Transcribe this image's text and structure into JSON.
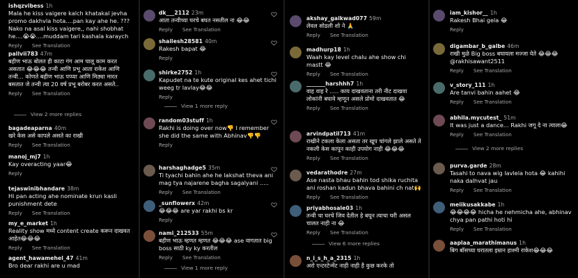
{
  "labels": {
    "reply": "Reply",
    "see_translation": "See Translation"
  },
  "col1": [
    {
      "user": "ishqzvibess",
      "time": "1h",
      "text": "Mala he kiss vaigere kalch khatakal jevha promo dakhvla hota....pan kay ahe he. ???\nNako na asal kiss vaigere,, nahi shobhat he....😭😭....muddam tari kashala karaych",
      "acts": true,
      "trans": true
    },
    {
      "user": "pallvii783",
      "time": "47m",
      "text": "बहीण भाऊ बोलत ही काटा गंग आम चालू काम करत असतात 😂😂😂 तन्वी आणि प्रभू आता राकेश आणि तन्वी... कोणते बहीण भाऊ पप्प्या आणि मिठ्या मारत बसतात जे तन्वी त्या 20 वर्ष प्रभू बरोबर करत असते..",
      "acts": true,
      "trans": true,
      "more": "View 2 more replies"
    },
    {
      "user": "bagadeaparna",
      "time": "40m",
      "text": "खरे केस असे कापले असते का राखी",
      "acts": true,
      "trans": true
    },
    {
      "user": "manoj_mj7",
      "time": "1h",
      "text": "Kay overacting yaar😂",
      "acts": true,
      "trans": false
    },
    {
      "user": "tejaswinibhandare",
      "time": "38m",
      "text": "Hi pan acting ahe nominate krun kasli punishment dete",
      "acts": true,
      "trans": true
    },
    {
      "user": "my_e_market",
      "time": "1h",
      "text": "Reality show मध्ये content create करून दाखवत आहेत😂😂😂",
      "acts": true,
      "trans": true
    },
    {
      "user": "agent_hawamehel_47",
      "time": "41m",
      "text": "Bro dear rakhi are u mad",
      "acts": false,
      "trans": false
    }
  ],
  "col2": [
    {
      "user": "dk___2112",
      "time": "23m",
      "text": "आता तन्वीच्या घरचे बघत नसतील ना 😂😂",
      "acts": true,
      "trans": true
    },
    {
      "user": "shailesh28581",
      "time": "40m",
      "text": "Rakesh bapat 😂",
      "acts": true,
      "trans": false
    },
    {
      "user": "shirke2752",
      "time": "1h",
      "text": "Kapudet na te kute original kes ahet tichi weeg tr lavlay😂😂",
      "acts": true,
      "trans": false,
      "more": "View 1 more reply"
    },
    {
      "user": "random03stuff",
      "time": "1h",
      "text": "Rakhi is doing over now👎 I remember she did the same with Abhinav👎👎",
      "acts": true,
      "trans": false
    },
    {
      "user": "harshaghadge5",
      "time": "35m",
      "text": "Ti tyachi bahin ahe he lakshat theva ani mag tya najarene bagha sagalyani .....",
      "acts": true,
      "trans": true
    },
    {
      "user": "_sunflowerx",
      "time": "42m",
      "text": "😂😂😂 are yar rakhi bs kr",
      "acts": true,
      "trans": false
    },
    {
      "user": "nami_212533",
      "time": "55m",
      "text": "बहीण भाऊ म्हणत म्हणत 😂😂😂 ase वागतात big boss साठी ky ky करतील",
      "acts": true,
      "trans": true,
      "more": "View 1 more reply"
    }
  ],
  "col3": [
    {
      "user": "akshay_gaikwad077",
      "time": "59m",
      "text": "लेवल सोडली शो ने 🙏",
      "acts": true,
      "trans": true
    },
    {
      "user": "madhurp18",
      "time": "1h",
      "text": "Waah kay level chalu ahe show chi mastt 😂",
      "acts": true,
      "trans": true
    },
    {
      "user": "_______harshhh7",
      "time": "1h",
      "text": "वाह वाह रे ..... काय दाखवताना तरी नीट दाखवा लोकांनी बघावे म्हणून असले प्रोमो दाखवतात 😂",
      "acts": true,
      "trans": true
    },
    {
      "user": "arvindpatil713",
      "time": "41m",
      "text": "राखीने टकला केला असता तर खूप चांगले झाले असते ते नकली केस कापून काही उपयोग नाही 😂😂😂",
      "acts": true,
      "trans": true
    },
    {
      "user": "vedarathodre",
      "time": "27m",
      "text": "Ase nasta bhau bahin tod shika ruchita ani roshan kadun bhava bahini ch nat🙌",
      "acts": true,
      "trans": true
    },
    {
      "user": "priyabhosale03",
      "time": "1h",
      "text": "तन्वी चा घरचे जिव देतील हे बघून त्याचा घरी असल चालत नाही ना 😂",
      "acts": true,
      "trans": true,
      "more": "View 6 more replies"
    },
    {
      "user": "n_i_s_h_a_2315",
      "time": "1h",
      "text": "अरो एन्टरटेन्मेंट नाही नाही है कुछ करके तो",
      "acts": false,
      "trans": false
    }
  ],
  "col4": [
    {
      "user": "iam_kishor__",
      "time": "1h",
      "text": "Rakesh Bhai gela 😂",
      "acts": true,
      "trans": false
    },
    {
      "user": "digambar_b_galbe",
      "time": "46m",
      "text": "राखी मुळे Big boss बघायला मज्जा येते 😂😂😂 @rakhisawant2511",
      "acts": true,
      "trans": true
    },
    {
      "user": "v_story_111",
      "time": "1h",
      "text": "Are tanvi bahin aahet 😂",
      "acts": true,
      "trans": true
    },
    {
      "user": "abhila.mycutest_",
      "time": "51m",
      "text": "It was just a dance... Rakhi जगू दे ना त्याला😂",
      "acts": true,
      "trans": true,
      "more": "View 2 more replies"
    },
    {
      "user": "purva.garde",
      "time": "28m",
      "text": "Tasahi to nava wig lavlela hota 😂 kahihi naka dalhvat jau",
      "acts": true,
      "trans": true
    },
    {
      "user": "meiikusakkabe",
      "time": "1h",
      "text": "😂😂😂😂 hicha he nehmicha ahe, abhinav chya pan pathi hoti hi",
      "acts": true,
      "trans": true
    },
    {
      "user": "aaplaa_marathimanus",
      "time": "1h",
      "text": "बिग बॉसच्या घरातला इम्रान हाश्मी राकेश😂😂😂",
      "acts": false,
      "trans": false
    }
  ]
}
